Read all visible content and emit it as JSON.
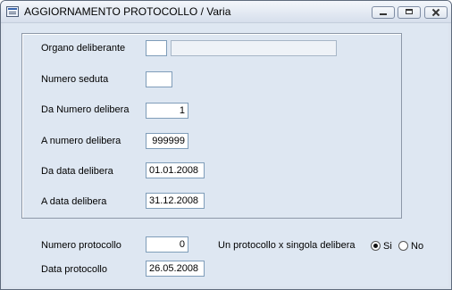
{
  "window": {
    "title": "AGGIORNAMENTO PROTOCOLLO / Varia"
  },
  "titlebar": {
    "icons": {
      "app": "window-form-icon",
      "minimize": "minimize-icon",
      "maximize": "maximize-icon",
      "close": "close-icon"
    }
  },
  "form": {
    "organo_label": "Organo deliberante",
    "organo_code": "",
    "organo_desc": "",
    "seduta_label": "Numero seduta",
    "seduta_value": "",
    "da_numero_label": "Da Numero delibera",
    "da_numero_value": "1",
    "a_numero_label": "A  numero delibera",
    "a_numero_value": "999999",
    "da_data_label": "Da data delibera",
    "da_data_value": "01.01.2008",
    "a_data_label": "A  data delibera",
    "a_data_value": "31.12.2008"
  },
  "protocol": {
    "numero_label": "Numero protocollo",
    "numero_value": "0",
    "data_label": "Data protocollo",
    "data_value": "26.05.2008",
    "singola_label": "Un protocollo x singola delibera",
    "option_si": "Si",
    "option_no": "No",
    "selected": "Si"
  }
}
